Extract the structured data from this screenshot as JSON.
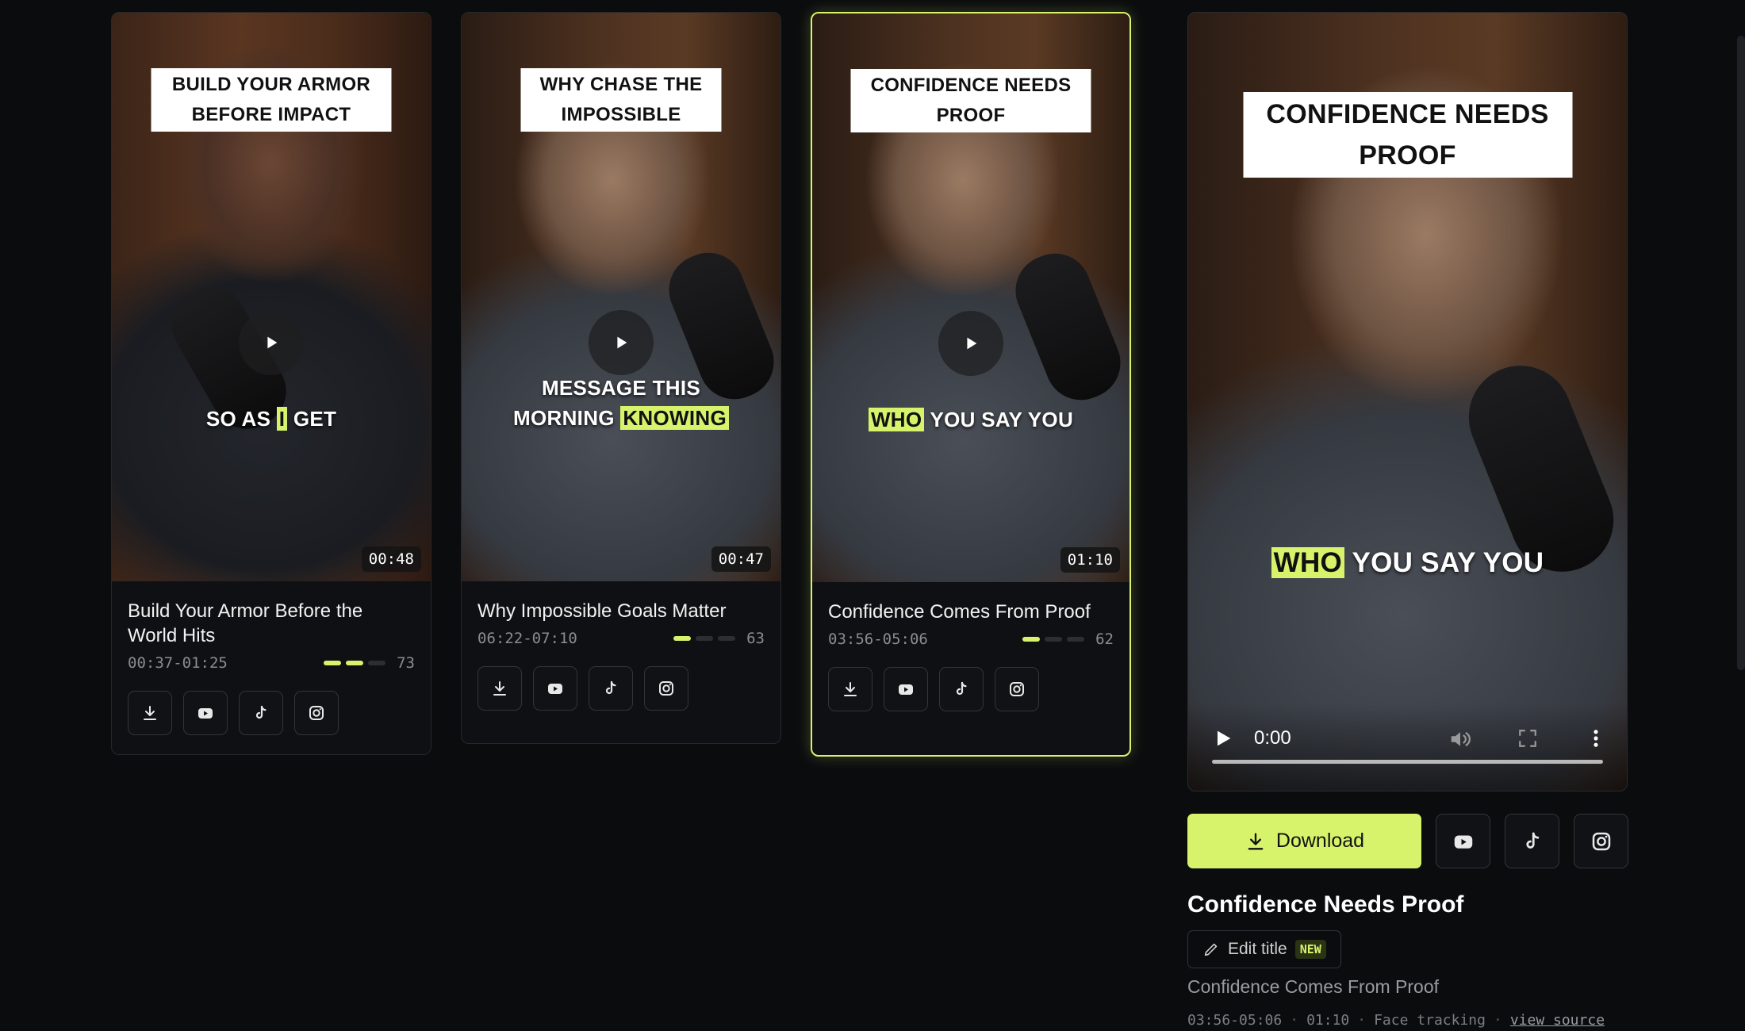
{
  "clips": [
    {
      "overlay_title": "BUILD YOUR ARMOR BEFORE IMPACT",
      "caption_before": "SO AS ",
      "caption_highlight": "I",
      "caption_after": " GET",
      "duration": "00:48",
      "title": "Build Your Armor Before the World Hits",
      "range": "00:37-01:25",
      "score": "73",
      "score_level": 2
    },
    {
      "overlay_title": "WHY CHASE THE IMPOSSIBLE",
      "caption_line1": "MESSAGE THIS",
      "caption_before": "MORNING ",
      "caption_highlight": "KNOWING",
      "caption_after": "",
      "duration": "00:47",
      "title": "Why Impossible Goals Matter",
      "range": "06:22-07:10",
      "score": "63",
      "score_level": 1
    },
    {
      "overlay_title": "CONFIDENCE NEEDS PROOF",
      "caption_before": "",
      "caption_highlight": "WHO",
      "caption_after": " YOU SAY YOU",
      "duration": "01:10",
      "title": "Confidence Comes From Proof",
      "range": "03:56-05:06",
      "score": "62",
      "score_level": 1,
      "selected": true
    }
  ],
  "preview": {
    "overlay_title": "CONFIDENCE NEEDS PROOF",
    "caption_highlight": "WHO",
    "caption_after": " YOU SAY YOU",
    "time": "0:00",
    "download_label": "Download",
    "title": "Confidence Needs Proof",
    "edit_label": "Edit title",
    "new_badge": "NEW",
    "subtitle": "Confidence Comes From Proof",
    "meta_range": "03:56-05:06",
    "meta_duration": "01:10",
    "meta_tracking": "Face tracking",
    "meta_link": "view source"
  },
  "icons": [
    "download-icon",
    "youtube-icon",
    "tiktok-icon",
    "instagram-icon",
    "play-icon",
    "volume-icon",
    "fullscreen-icon",
    "more-icon",
    "pencil-icon"
  ],
  "colors": {
    "accent": "#d6f36b",
    "background": "#0b0c0e",
    "card": "#0f1013"
  }
}
